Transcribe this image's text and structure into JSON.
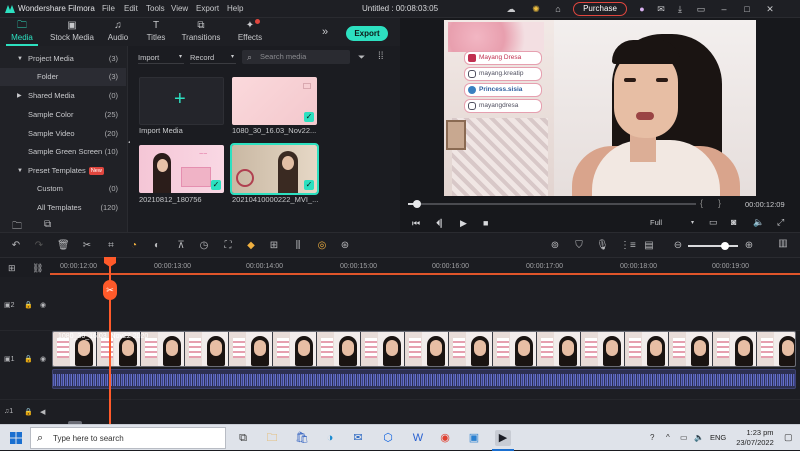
{
  "app": {
    "name": "Wondershare Filmora",
    "document_title": "Untitled : 00:08:03:05",
    "purchase_label": "Purchase"
  },
  "menu": [
    "File",
    "Edit",
    "Tools",
    "View",
    "Export",
    "Help"
  ],
  "tabs": [
    {
      "label": "Media",
      "icon": "folder-icon",
      "active": true
    },
    {
      "label": "Stock Media",
      "icon": "stock-media-icon",
      "active": false
    },
    {
      "label": "Audio",
      "icon": "music-note-icon",
      "active": false
    },
    {
      "label": "Titles",
      "icon": "text-t-icon",
      "active": false
    },
    {
      "label": "Transitions",
      "icon": "transitions-icon",
      "active": false
    },
    {
      "label": "Effects",
      "icon": "effects-icon",
      "active": false
    }
  ],
  "export_label": "Export",
  "sidebar": [
    {
      "label": "Project Media",
      "count": "(3)",
      "caret": "▼"
    },
    {
      "label": "Folder",
      "count": "(3)",
      "selected": true
    },
    {
      "label": "Shared Media",
      "count": "(0)",
      "caret": "▶"
    },
    {
      "label": "Sample Color",
      "count": "(25)"
    },
    {
      "label": "Sample Video",
      "count": "(20)"
    },
    {
      "label": "Sample Green Screen",
      "count": "(10)"
    },
    {
      "label": "Preset Templates",
      "count": "",
      "caret": "▼",
      "badge": "New"
    },
    {
      "label": "Custom",
      "count": "(0)"
    },
    {
      "label": "All Templates",
      "count": "(120)"
    }
  ],
  "media_toolbar": {
    "import_label": "Import",
    "record_label": "Record",
    "search_placeholder": "Search media"
  },
  "media_items": [
    {
      "caption": "Import Media"
    },
    {
      "caption": "1080_30_16.03_Nov22..."
    },
    {
      "caption": "20210812_180756"
    },
    {
      "caption": "20210410000222_MVI_..."
    }
  ],
  "video_overlay": {
    "badges": [
      "Mayang Dresa",
      "mayang.kreatip",
      "Princess.sisia",
      "mayangdresa"
    ]
  },
  "player": {
    "timecode": "00:00:12:09",
    "quality": "Full",
    "progress": 0.03
  },
  "ruler": [
    "00:00:12:00",
    "00:00:13:00",
    "00:00:14:00",
    "00:00:15:00",
    "00:00:16:00",
    "00:00:17:00",
    "00:00:18:00",
    "00:00:19:00"
  ],
  "clip_label": "1080_30_16.03_Nov22 2020",
  "tracks": [
    "2",
    "1",
    "1"
  ],
  "taskbar": {
    "search_placeholder": "Type here to search",
    "language": "ENG",
    "time": "1:23 pm",
    "date": "23/07/2022"
  },
  "colors": {
    "accent": "#2de0c0",
    "playhead": "#ff5a2a",
    "purchase": "#e0463e"
  }
}
